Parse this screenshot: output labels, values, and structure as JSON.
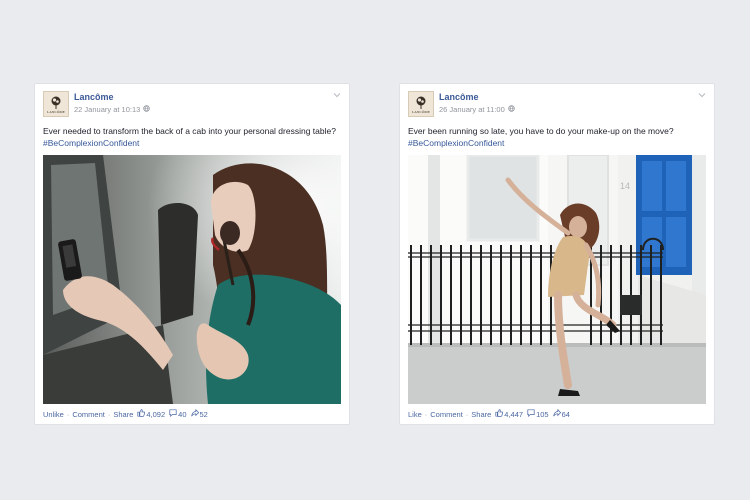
{
  "posts": [
    {
      "page_name": "Lancôme",
      "logo_text": "LANCÔME",
      "date": "22 January at 10:13",
      "text": "Ever needed to transform the back of a cab into your personal dressing table?",
      "hashtag": "#BeComplexionConfident",
      "actions": {
        "like": "Unlike",
        "comment": "Comment",
        "share": "Share",
        "sep": "·"
      },
      "counts": {
        "likes": "4,092",
        "comments": "40",
        "shares": "52"
      }
    },
    {
      "page_name": "Lancôme",
      "logo_text": "LANCÔME",
      "date": "26 January at 11:00",
      "text": "Ever been running so late, you have to do your make-up on the move?",
      "hashtag": "#BeComplexionConfident",
      "actions": {
        "like": "Like",
        "comment": "Comment",
        "share": "Share",
        "sep": "·"
      },
      "counts": {
        "likes": "4,447",
        "comments": "105",
        "shares": "64"
      },
      "house_number": "14"
    }
  ],
  "colors": {
    "link": "#3b5998",
    "meta": "#90949c",
    "card": "#ffffff",
    "background": "#e9ebee"
  }
}
